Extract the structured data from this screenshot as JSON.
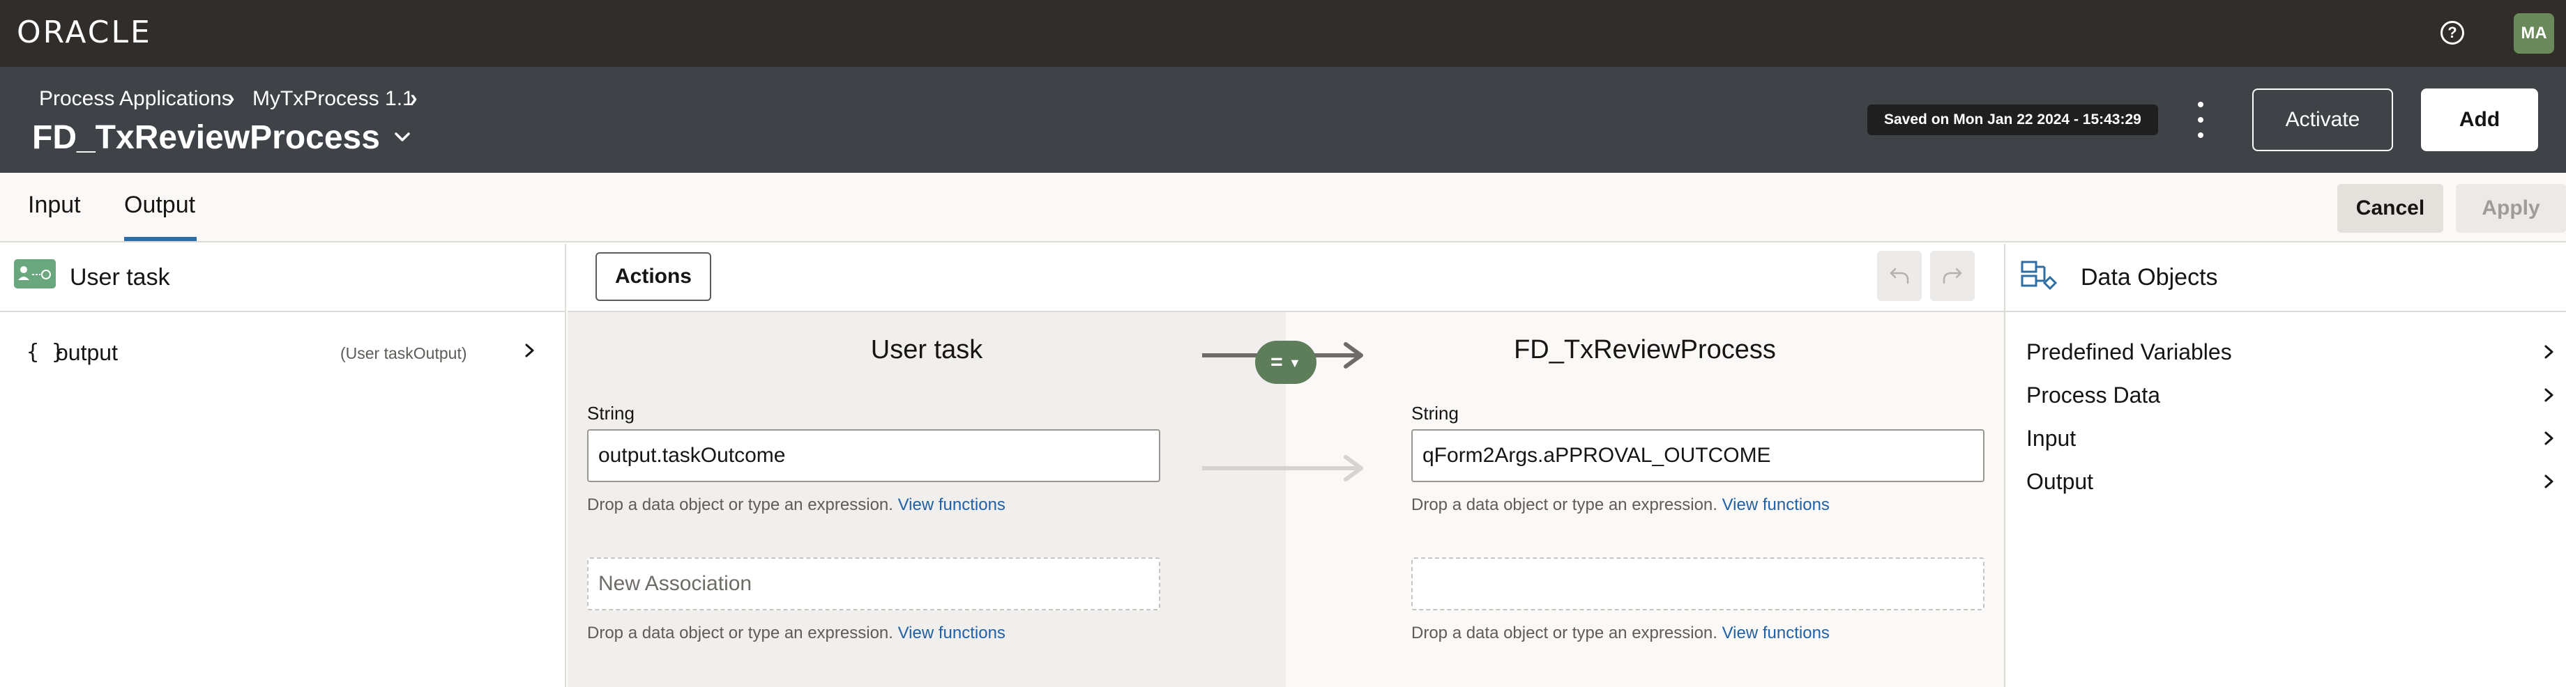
{
  "topbar": {
    "brand": "ORACLE",
    "help_icon": "help-circle-icon",
    "avatar_initials": "MA"
  },
  "header": {
    "breadcrumbs": [
      "Process Applications",
      "MyTxProcess 1.1"
    ],
    "title": "FD_TxReviewProcess",
    "saved_text": "Saved on Mon Jan 22 2024 - 15:43:29",
    "activate_label": "Activate",
    "add_label": "Add"
  },
  "tabs": {
    "items": [
      "Input",
      "Output"
    ],
    "selected": "Output",
    "cancel_label": "Cancel",
    "apply_label": "Apply"
  },
  "left_panel": {
    "title": "User task",
    "tree": [
      {
        "name": "output",
        "type": "(User taskOutput)"
      }
    ]
  },
  "mapping": {
    "actions_label": "Actions",
    "source_title": "User task",
    "target_title": "FD_TxReviewProcess",
    "rows": [
      {
        "source_label": "String",
        "source_value": "output.taskOutcome",
        "target_label": "String",
        "target_value": "qForm2Args.aPPROVAL_OUTCOME",
        "operator": "="
      }
    ],
    "new_association_placeholder": "New Association",
    "hint_text": "Drop a data object or type an expression.",
    "view_functions": "View functions"
  },
  "right_panel": {
    "title": "Data Objects",
    "items": [
      "Predefined Variables",
      "Process Data",
      "Input",
      "Output"
    ]
  },
  "colors": {
    "topbar": "#312d2a",
    "header": "#3f4347",
    "accent": "#2f6ea5",
    "mapping_operator": "#5e7d5a",
    "link": "#2160a3"
  }
}
